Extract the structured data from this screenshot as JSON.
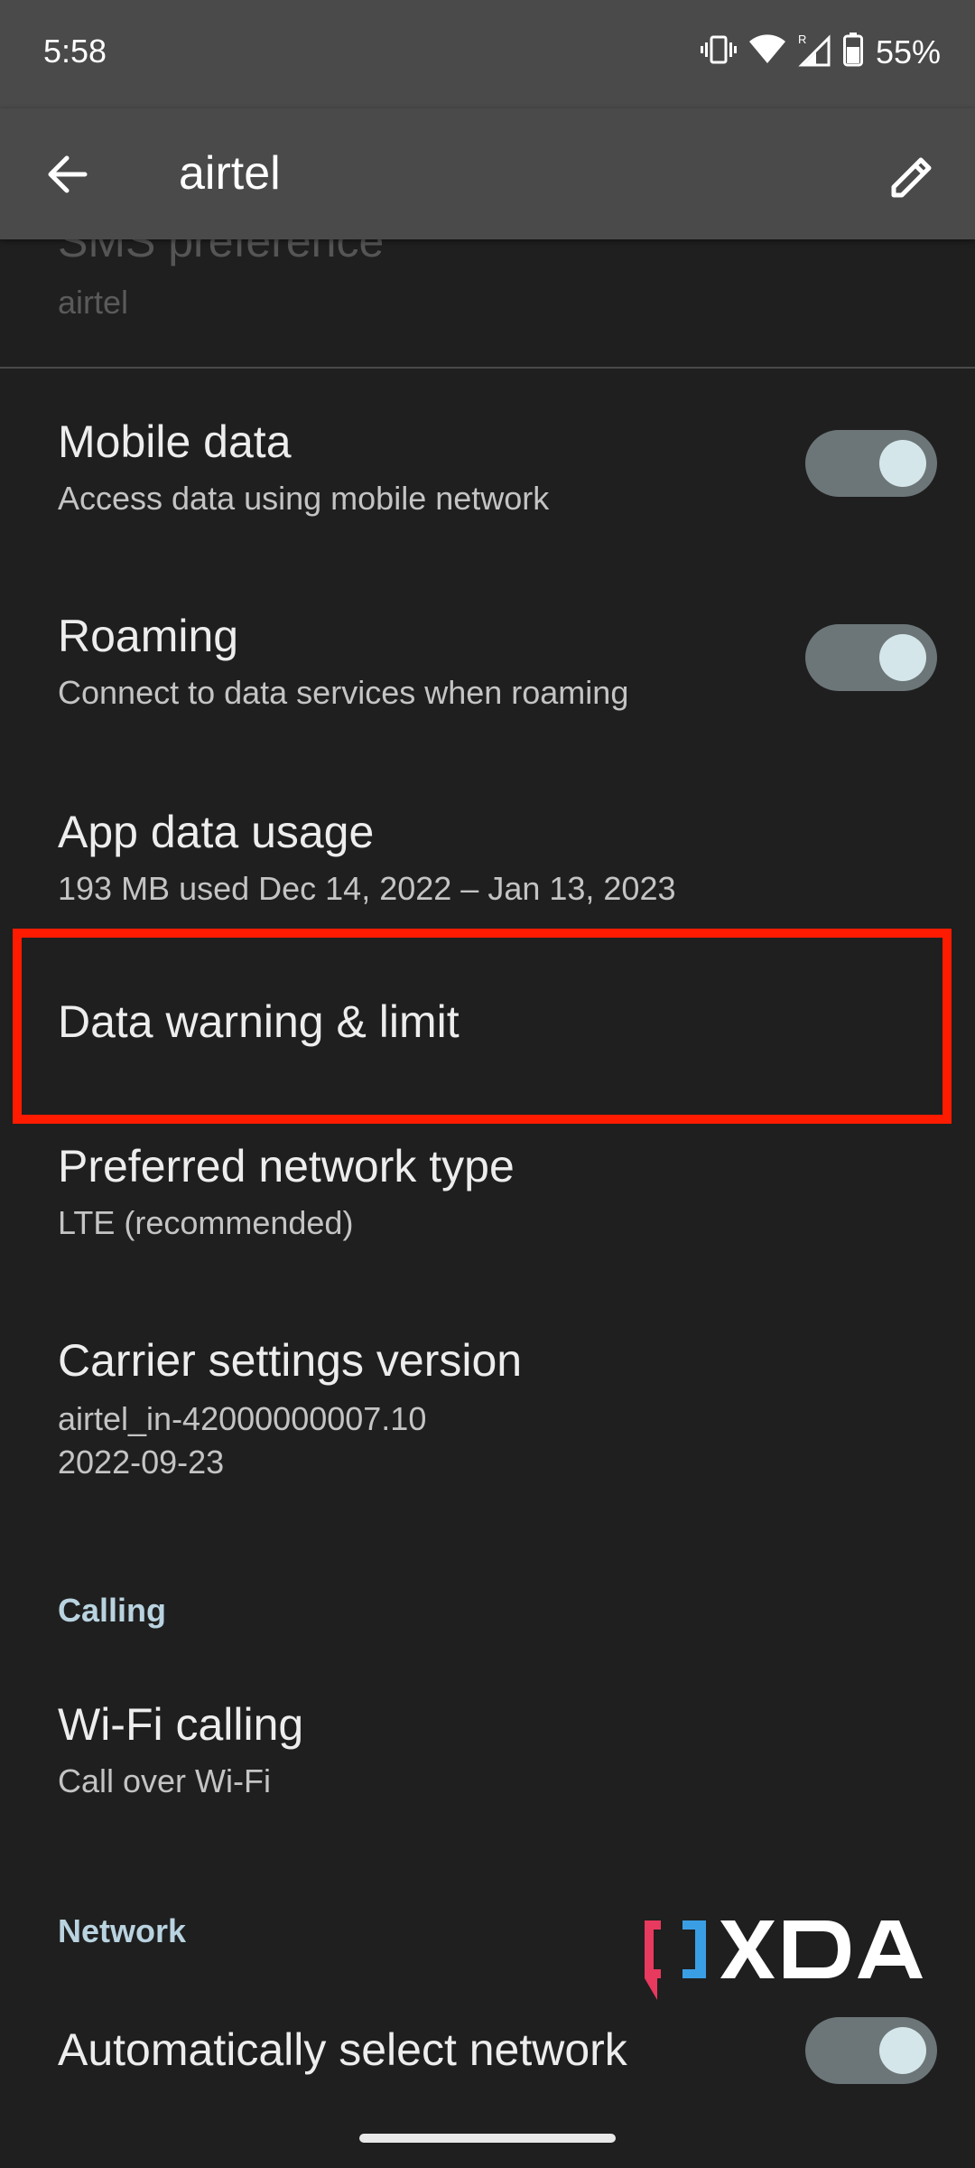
{
  "status_bar": {
    "time": "5:58",
    "battery_percent": "55%",
    "icons": [
      "vibrate-icon",
      "wifi-icon",
      "signal-roaming-icon",
      "battery-icon"
    ]
  },
  "app_bar": {
    "title": "airtel",
    "back_icon": "arrow-left-icon",
    "edit_icon": "pencil-icon"
  },
  "partial_item": {
    "title": "SMS preference",
    "subtitle": "airtel"
  },
  "items": [
    {
      "title": "Mobile data",
      "subtitle": "Access data using mobile network",
      "toggle": true
    },
    {
      "title": "Roaming",
      "subtitle": "Connect to data services when roaming",
      "toggle": true
    },
    {
      "title": "App data usage",
      "subtitle": "193 MB used Dec 14, 2022 – Jan 13, 2023"
    },
    {
      "title": "Data warning & limit"
    },
    {
      "title": "Preferred network type",
      "subtitle": "LTE (recommended)"
    },
    {
      "title": "Carrier settings version",
      "subtitle_line1": "airtel_in-42000000007.10",
      "subtitle_line2": "2022-09-23"
    }
  ],
  "sections": {
    "calling": "Calling",
    "network": "Network"
  },
  "calling_items": [
    {
      "title": "Wi-Fi calling",
      "subtitle": "Call over Wi-Fi"
    }
  ],
  "network_items": [
    {
      "title": "Automatically select network",
      "toggle": true
    }
  ],
  "watermark": {
    "text": "XDA",
    "colors": {
      "bracket_left": "#e8395e",
      "bracket_right": "#3a9ee4",
      "text": "#ffffff"
    }
  },
  "colors": {
    "background": "#1f1f1f",
    "bars": "#4a4a4a",
    "highlight": "#ff1b00",
    "section_header": "#b9d3e0",
    "toggle_track": "#6c7678",
    "toggle_knob": "#d4e6ea"
  }
}
